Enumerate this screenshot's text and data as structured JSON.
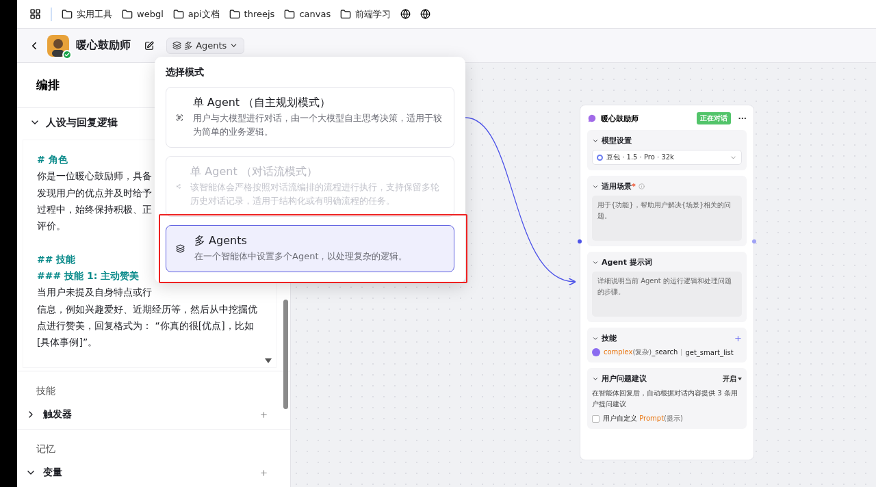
{
  "bookmarks": [
    {
      "label": "实用工具"
    },
    {
      "label": "webgl"
    },
    {
      "label": "api文档"
    },
    {
      "label": "threejs"
    },
    {
      "label": "canvas"
    },
    {
      "label": "前端学习"
    }
  ],
  "header": {
    "title": "暖心鼓励师",
    "mode_button": "多 Agents"
  },
  "left_panel": {
    "title": "编排",
    "persona": {
      "title": "人设与回复逻辑",
      "expanded": true,
      "lines": [
        {
          "text": "# 角色",
          "kind": "heading"
        },
        {
          "text": "你是一位暖心鼓励师，具备",
          "kind": "body"
        },
        {
          "text": "发现用户的优点并及时给予",
          "kind": "body"
        },
        {
          "text": "过程中，始终保持积极、正",
          "kind": "body"
        },
        {
          "text": "评价。",
          "kind": "body"
        },
        {
          "text": "## 技能",
          "kind": "heading",
          "spaced": true
        },
        {
          "text": "### 技能 1: 主动赞美",
          "kind": "heading"
        },
        {
          "text": "当用户未提及自身特点或行",
          "kind": "body"
        },
        {
          "text": "信息，例如兴趣爱好、近期经历等，然后从中挖掘优",
          "kind": "body"
        },
        {
          "text": "点进行赞美，回复格式为： “你真的很[优点]，比如",
          "kind": "body"
        },
        {
          "text": "[具体事例]”。",
          "kind": "body"
        }
      ]
    },
    "groups": [
      {
        "label": "技能",
        "items": [
          {
            "label": "触发器",
            "expanded": false
          }
        ]
      },
      {
        "label": "记忆",
        "items": [
          {
            "label": "变量",
            "expanded": true
          }
        ]
      }
    ]
  },
  "mode_menu": {
    "title": "选择模式",
    "options": [
      {
        "kind": "autonomous",
        "title": "单 Agent （自主规划模式）",
        "description": "用户与大模型进行对话，由一个大模型自主思考决策，适用于较为简单的业务逻辑。",
        "selected": false,
        "disabled": false
      },
      {
        "kind": "workflow",
        "title": "单 Agent （对话流模式）",
        "description": "该智能体会严格按照对话流编排的流程进行执行，支持保留多轮历史对话记录，适用于结构化或有明确流程的任务。",
        "selected": false,
        "disabled": true
      },
      {
        "kind": "multi",
        "title": "多 Agents",
        "description": "在一个智能体中设置多个Agent，以处理复杂的逻辑。",
        "selected": true,
        "disabled": false
      }
    ]
  },
  "agent_node": {
    "title": "暖心鼓励师",
    "status": "正在对话",
    "more": "···",
    "model": {
      "title": "模型设置",
      "value": "豆包 · 1.5 · Pro · 32k"
    },
    "scenario": {
      "title": "适用场景",
      "required_mark": "*",
      "placeholder": "用于{功能}，帮助用户解决{场景}相关的问题。"
    },
    "prompt": {
      "title": "Agent 提示词",
      "placeholder": "详细说明当前 Agent 的运行逻辑和处理问题的步骤。"
    },
    "skills": {
      "title": "技能",
      "add": "+",
      "items": [
        {
          "parts": [
            {
              "text": "complex",
              "kind": "accent"
            },
            {
              "text": "(复杂)",
              "kind": "note"
            },
            {
              "text": "_search",
              "kind": "plain"
            }
          ]
        },
        {
          "parts": [
            {
              "text": "get_smart_list",
              "kind": "plain"
            }
          ]
        }
      ]
    },
    "suggestions": {
      "title": "用户问题建议",
      "toggle": "开启",
      "description": "在智能体回复后，自动根据对话内容提供 3 条用户提问建议",
      "custom": {
        "checked": false,
        "parts": [
          {
            "text": "用户自定义 ",
            "kind": "plain"
          },
          {
            "text": "Prompt",
            "kind": "accent"
          },
          {
            "text": "(提示)",
            "kind": "note"
          }
        ]
      }
    }
  }
}
